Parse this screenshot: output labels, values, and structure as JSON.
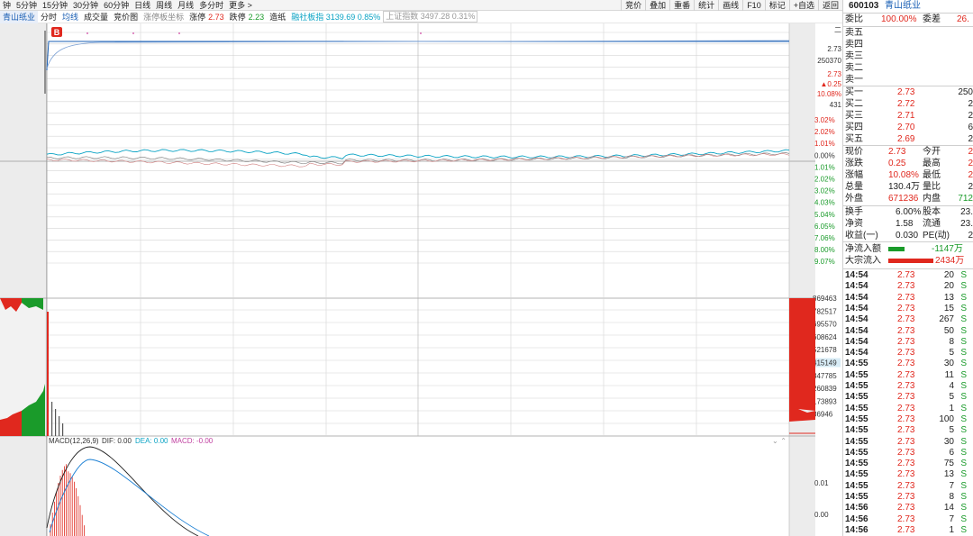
{
  "toolbar": {
    "periods": [
      "钟",
      "5分钟",
      "15分钟",
      "30分钟",
      "60分钟",
      "日线",
      "周线",
      "月线",
      "多分时",
      "更多 >"
    ],
    "tools": [
      "竞价",
      "叠加",
      "重番",
      "统计",
      "画线",
      "F10",
      "标记",
      "+自选",
      "返回"
    ]
  },
  "subbar": {
    "stock_name": "青山纸业",
    "tab_fenshi": "分时",
    "tab_junxian": "均线",
    "tab_volume": "成交量",
    "tab_chips": "竞价图",
    "tab_limit_coord": "涨停板坐标",
    "limit_up_label": "涨停",
    "limit_up_value": "2.73",
    "limit_down_label": "跌停",
    "limit_down_value": "2.23",
    "paper_label": "造纸",
    "index_label": "融社板指 3139.69 0.85%",
    "sh_index": "上证指数 3497.28 0.31%"
  },
  "chart": {
    "b_marker": "B",
    "price_axis_top": [
      "二",
      "2.73",
      "250370",
      "2.73",
      "▲0.25",
      "10.08%",
      "431"
    ],
    "pct_axis": [
      "3.02%",
      "2.02%",
      "1.01%",
      "0.00%",
      "1.01%",
      "2.02%",
      "3.02%",
      "4.03%",
      "5.04%",
      "6.05%",
      "7.06%",
      "8.00%",
      "9.07%"
    ],
    "vol_axis": [
      "869463",
      "782517",
      "695570",
      "608624",
      "521678",
      "415149",
      "347785",
      "260839",
      "173893",
      "86946"
    ],
    "macd_label": "MACD(12,26,9)",
    "macd_dif_label": "DIF: 0.00",
    "macd_dea_label": "DEA: 0.00",
    "macd_macd_label": "MACD: -0.00",
    "macd_axis": [
      "0.01",
      "0.00"
    ],
    "colors": {
      "price_line": "#1a5fb4",
      "avg_line": "#e0b020",
      "red": "#e0281e",
      "green": "#1a9b2a",
      "cyan": "#0aa3c4"
    }
  },
  "panel": {
    "code": "600103",
    "name": "青山纸业",
    "weibi_label": "委比",
    "weibi_value": "100.00%",
    "weicha_label": "委差",
    "weicha_value": "26.",
    "sells": [
      {
        "label": "卖五"
      },
      {
        "label": "卖四"
      },
      {
        "label": "卖三"
      },
      {
        "label": "卖二"
      },
      {
        "label": "卖一"
      }
    ],
    "buys": [
      {
        "label": "买一",
        "price": "2.73",
        "vol": "250"
      },
      {
        "label": "买二",
        "price": "2.72",
        "vol": "2"
      },
      {
        "label": "买三",
        "price": "2.71",
        "vol": "2"
      },
      {
        "label": "买四",
        "price": "2.70",
        "vol": "6"
      },
      {
        "label": "买五",
        "price": "2.69",
        "vol": "2"
      }
    ],
    "stats": [
      {
        "l1": "现价",
        "v1": "2.73",
        "l2": "今开",
        "v2": "2",
        "c1": "red",
        "c2": "red"
      },
      {
        "l1": "涨跌",
        "v1": "0.25",
        "l2": "最高",
        "v2": "2",
        "c1": "red",
        "c2": "red"
      },
      {
        "l1": "涨幅",
        "v1": "10.08%",
        "l2": "最低",
        "v2": "2",
        "c1": "red",
        "c2": "red"
      },
      {
        "l1": "总量",
        "v1": "130.4万",
        "l2": "量比",
        "v2": "2",
        "c1": "",
        "c2": ""
      },
      {
        "l1": "外盘",
        "v1": "671236",
        "l2": "内盘",
        "v2": "712",
        "c1": "red",
        "c2": "green"
      }
    ],
    "stats2": [
      {
        "l1": "换手",
        "v1": "6.00%",
        "l2": "股本",
        "v2": "23."
      },
      {
        "l1": "净资",
        "v1": "1.58",
        "l2": "流通",
        "v2": "23."
      },
      {
        "l1": "收益(一)",
        "v1": "0.030",
        "l2": "PE(动)",
        "v2": "2"
      }
    ],
    "inflow_label": "净流入额",
    "inflow_value": "-1147万",
    "big_label": "大宗流入",
    "big_value": "2434万",
    "ticks": [
      {
        "t": "14:54",
        "p": "2.73",
        "v": "20",
        "s": "S"
      },
      {
        "t": "14:54",
        "p": "2.73",
        "v": "20",
        "s": "S"
      },
      {
        "t": "14:54",
        "p": "2.73",
        "v": "13",
        "s": "S"
      },
      {
        "t": "14:54",
        "p": "2.73",
        "v": "15",
        "s": "S"
      },
      {
        "t": "14:54",
        "p": "2.73",
        "v": "267",
        "s": "S"
      },
      {
        "t": "14:54",
        "p": "2.73",
        "v": "50",
        "s": "S"
      },
      {
        "t": "14:54",
        "p": "2.73",
        "v": "8",
        "s": "S"
      },
      {
        "t": "14:54",
        "p": "2.73",
        "v": "5",
        "s": "S"
      },
      {
        "t": "14:55",
        "p": "2.73",
        "v": "30",
        "s": "S"
      },
      {
        "t": "14:55",
        "p": "2.73",
        "v": "11",
        "s": "S"
      },
      {
        "t": "14:55",
        "p": "2.73",
        "v": "4",
        "s": "S"
      },
      {
        "t": "14:55",
        "p": "2.73",
        "v": "5",
        "s": "S"
      },
      {
        "t": "14:55",
        "p": "2.73",
        "v": "1",
        "s": "S"
      },
      {
        "t": "14:55",
        "p": "2.73",
        "v": "100",
        "s": "S"
      },
      {
        "t": "14:55",
        "p": "2.73",
        "v": "5",
        "s": "S"
      },
      {
        "t": "14:55",
        "p": "2.73",
        "v": "30",
        "s": "S"
      },
      {
        "t": "14:55",
        "p": "2.73",
        "v": "6",
        "s": "S"
      },
      {
        "t": "14:55",
        "p": "2.73",
        "v": "75",
        "s": "S"
      },
      {
        "t": "14:55",
        "p": "2.73",
        "v": "13",
        "s": "S"
      },
      {
        "t": "14:55",
        "p": "2.73",
        "v": "7",
        "s": "S"
      },
      {
        "t": "14:55",
        "p": "2.73",
        "v": "8",
        "s": "S"
      },
      {
        "t": "14:56",
        "p": "2.73",
        "v": "14",
        "s": "S"
      },
      {
        "t": "14:56",
        "p": "2.73",
        "v": "7",
        "s": "S"
      },
      {
        "t": "14:56",
        "p": "2.73",
        "v": "1",
        "s": "S"
      }
    ]
  }
}
